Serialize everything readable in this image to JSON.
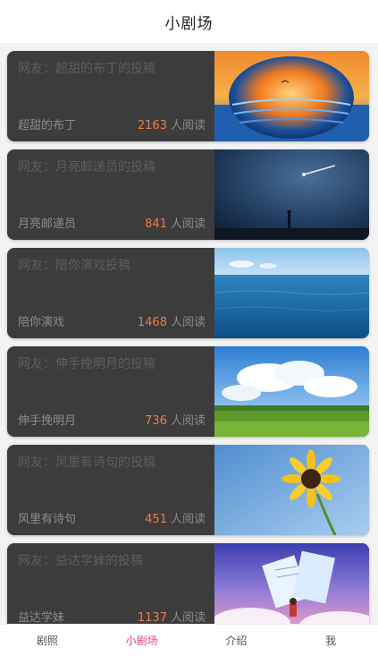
{
  "header": {
    "title": "小剧场"
  },
  "cards": [
    {
      "headline": "网友：超甜的布丁的投稿",
      "author": "超甜的布丁",
      "count": "2163",
      "reads_suffix": "人阅读"
    },
    {
      "headline": "网友：月亮邮递员的投稿",
      "author": "月亮邮递员",
      "count": "841",
      "reads_suffix": "人阅读"
    },
    {
      "headline": "网友：陪你演戏投稿",
      "author": "陪你演戏",
      "count": "1468",
      "reads_suffix": "人阅读"
    },
    {
      "headline": "网友：伸手挽明月的投稿",
      "author": "伸手挽明月",
      "count": "736",
      "reads_suffix": "人阅读"
    },
    {
      "headline": "网友：风里有诗句的投稿",
      "author": "风里有诗句",
      "count": "451",
      "reads_suffix": "人阅读"
    },
    {
      "headline": "网友：益达学妹的投稿",
      "author": "益达学妹",
      "count": "1137",
      "reads_suffix": "人阅读"
    }
  ],
  "tabs": [
    {
      "label": "剧照",
      "active": false
    },
    {
      "label": "小剧场",
      "active": true
    },
    {
      "label": "介绍",
      "active": false
    },
    {
      "label": "我",
      "active": false
    }
  ],
  "colors": {
    "accent": "#e0457b",
    "count": "#f07c4a",
    "card_bg": "#3c3c3c"
  }
}
